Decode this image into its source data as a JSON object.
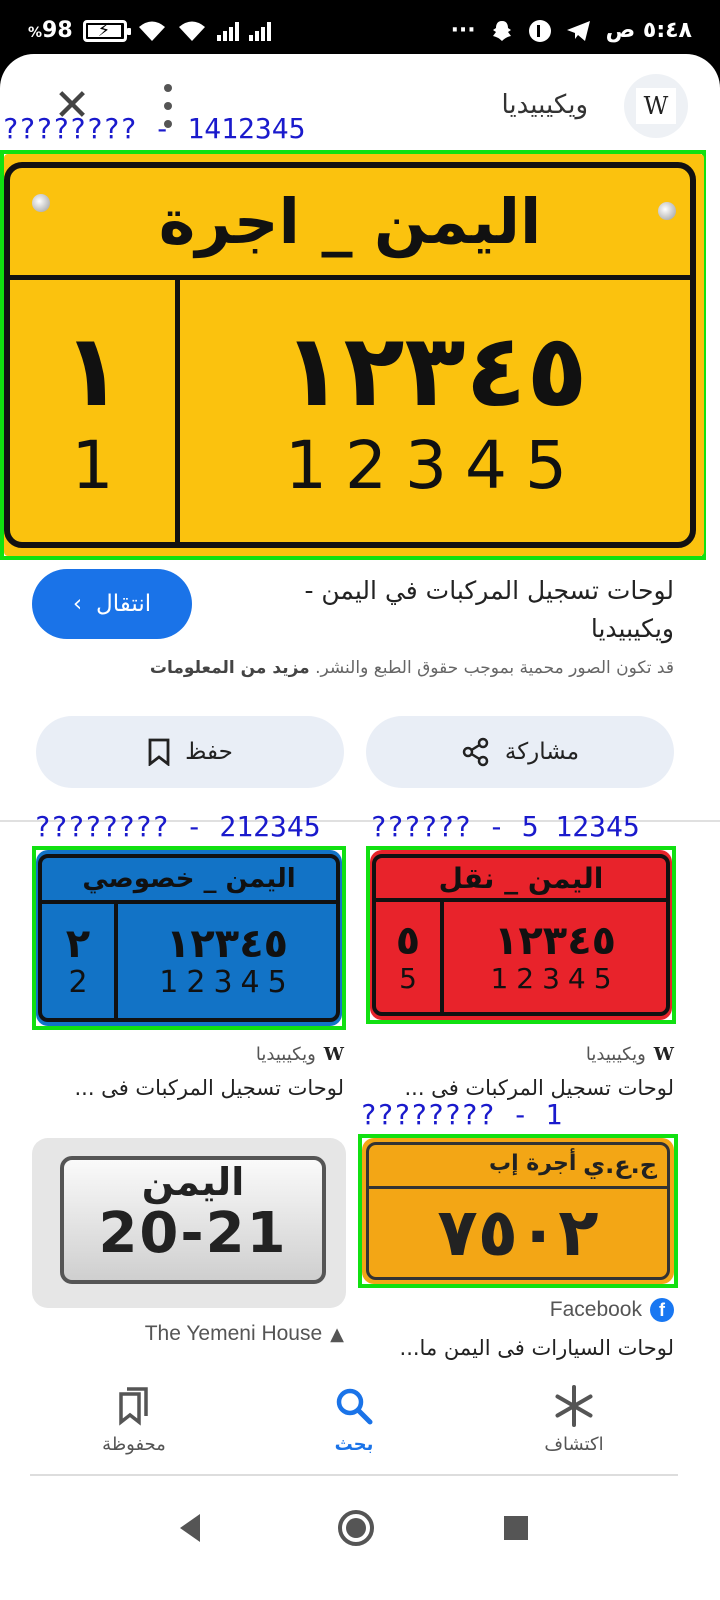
{
  "status_bar": {
    "battery_level": "98",
    "battery_pct_sign": "%",
    "time": "٥:٤٨ ص",
    "more_dots": "···"
  },
  "header": {
    "site_name": "ويكيبيديا",
    "site_logo_letter": "W",
    "close_glyph": "✕"
  },
  "overlay_labels": {
    "main": "???????? - 1412345",
    "card1": "???????? - 212345",
    "card2": "?????? - 5 12345",
    "card4": "???????? - 1"
  },
  "main_plate": {
    "top_text": "اليمن _ اجرة",
    "left_arabic": "١",
    "left_latin": "1",
    "right_arabic": "١٢٣٤٥",
    "right_latin": "12345",
    "color": "#fbc20e"
  },
  "result": {
    "title": "لوحات تسجيل المركبات في اليمن - ويكيبيديا",
    "copyright_note": "قد تكون الصور محمية بموجب حقوق الطبع والنشر.",
    "more_info": "مزيد من المعلومات",
    "go_button": "انتقال",
    "share_button": "مشاركة",
    "save_button": "حفظ"
  },
  "cards": [
    {
      "plate": {
        "top_text": "اليمن _ خصوصي",
        "left_arabic": "٢",
        "left_latin": "2",
        "right_arabic": "١٢٣٤٥",
        "right_latin": "12345",
        "color": "#1273c6"
      },
      "source": "ويكيبيديا",
      "source_icon": "W",
      "title": "لوحات تسجيل المركبات فى ..."
    },
    {
      "plate": {
        "top_text": "اليمن _ نقل",
        "left_arabic": "٥",
        "left_latin": "5",
        "right_arabic": "١٢٣٤٥",
        "right_latin": "12345",
        "color": "#e8232b"
      },
      "source": "ويكيبيديا",
      "source_icon": "W",
      "title": "لوحات تسجيل المركبات فى ..."
    },
    {
      "plate": {
        "top_text": "اليمن",
        "number": "20-21",
        "color": "#e6e6e6"
      },
      "source": "The Yemeni House",
      "title": ""
    },
    {
      "plate": {
        "top_left": "أجرة إب",
        "top_right": "ج.ع.ي",
        "number": "٧٥٠٢",
        "color": "#f3a615"
      },
      "source": "Facebook",
      "source_icon": "f",
      "title": "لوحات السيارات فى اليمن ما..."
    }
  ],
  "bottom_nav": {
    "saved": "محفوظة",
    "search": "بحث",
    "discover": "اكتشاف"
  },
  "colors": {
    "accent": "#1a73e8",
    "box": "#11e011",
    "label": "#1a1acc"
  }
}
